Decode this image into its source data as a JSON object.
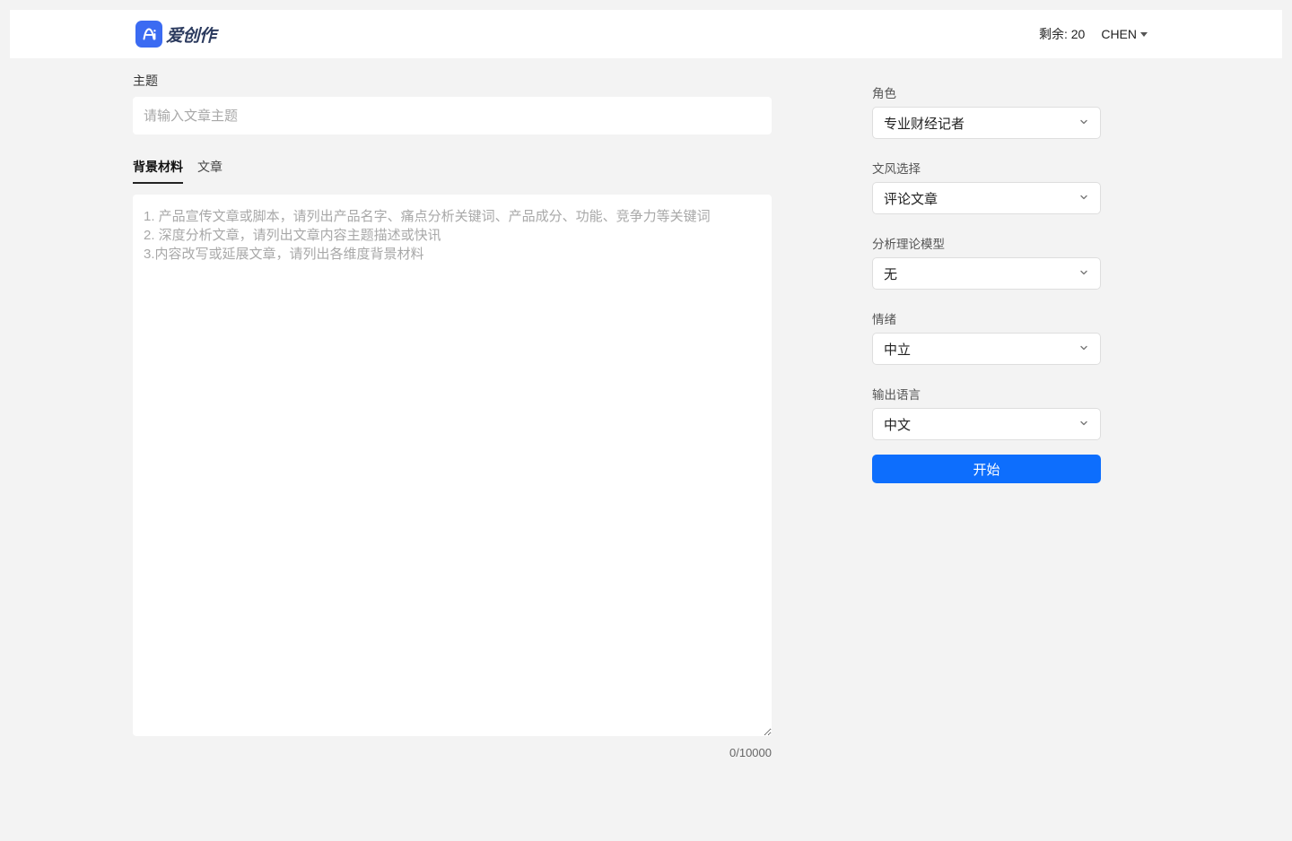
{
  "header": {
    "logo_text": "爱创作",
    "remaining_label": "剩余: 20",
    "user_name": "CHEN"
  },
  "main": {
    "subject_label": "主题",
    "subject_placeholder": "请输入文章主题",
    "tabs": {
      "background": "背景材料",
      "article": "文章"
    },
    "content_placeholder": "1. 产品宣传文章或脚本，请列出产品名字、痛点分析关键词、产品成分、功能、竞争力等关键词\n2. 深度分析文章，请列出文章内容主题描述或快讯\n3.内容改写或延展文章，请列出各维度背景材料",
    "char_count": "0/10000"
  },
  "sidebar": {
    "role": {
      "label": "角色",
      "value": "专业财经记者"
    },
    "style": {
      "label": "文风选择",
      "value": "评论文章"
    },
    "theory": {
      "label": "分析理论模型",
      "value": "无"
    },
    "emotion": {
      "label": "情绪",
      "value": "中立"
    },
    "language": {
      "label": "输出语言",
      "value": "中文"
    },
    "start_button": "开始"
  }
}
